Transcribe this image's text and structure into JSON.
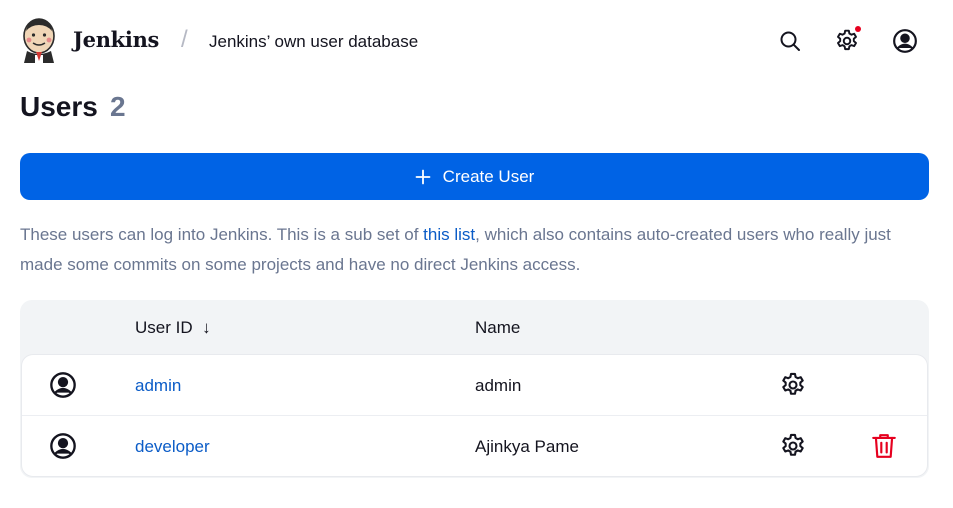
{
  "header": {
    "brand": "Jenkins",
    "breadcrumb_separator": "/",
    "breadcrumb": "Jenkins’ own user database",
    "icons": [
      "search-icon",
      "settings-icon",
      "user-account-icon"
    ],
    "notification_color": "#e6001f"
  },
  "page": {
    "title": "Users",
    "count": "2"
  },
  "create_button": {
    "icon": "plus-icon",
    "label": "Create User",
    "color": "#0063e5"
  },
  "description": {
    "before_link": "These users can log into Jenkins. This is a sub set of ",
    "link": "this list",
    "after_link": ", which also contains auto-created users who really just made some commits on some projects and have no direct Jenkins access."
  },
  "table": {
    "columns": {
      "user_id": "User ID",
      "sort_indicator": "↓",
      "name": "Name"
    },
    "rows": [
      {
        "user_id": "admin",
        "name": "admin",
        "has_delete": false
      },
      {
        "user_id": "developer",
        "name": "Ajinkya Pame",
        "has_delete": true
      }
    ],
    "delete_color": "#e6001f"
  }
}
